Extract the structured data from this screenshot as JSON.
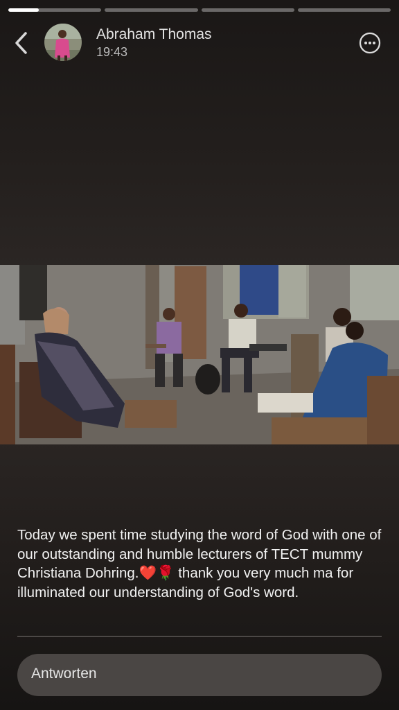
{
  "progress": {
    "segments": [
      0.33,
      0,
      0,
      0
    ]
  },
  "story": {
    "author_name": "Abraham Thomas",
    "posted_time": "19:43",
    "caption": "Today we spent time studying the word of God with one of our outstanding and humble lecturers of TECT mummy Christiana Dohring.❤️🌹 thank you very much ma for illuminated our understanding of God's word."
  },
  "icons": {
    "back": "chevron-left-icon",
    "more": "more-options-icon",
    "reply": "reply-input"
  },
  "reply": {
    "placeholder": "Antworten"
  }
}
